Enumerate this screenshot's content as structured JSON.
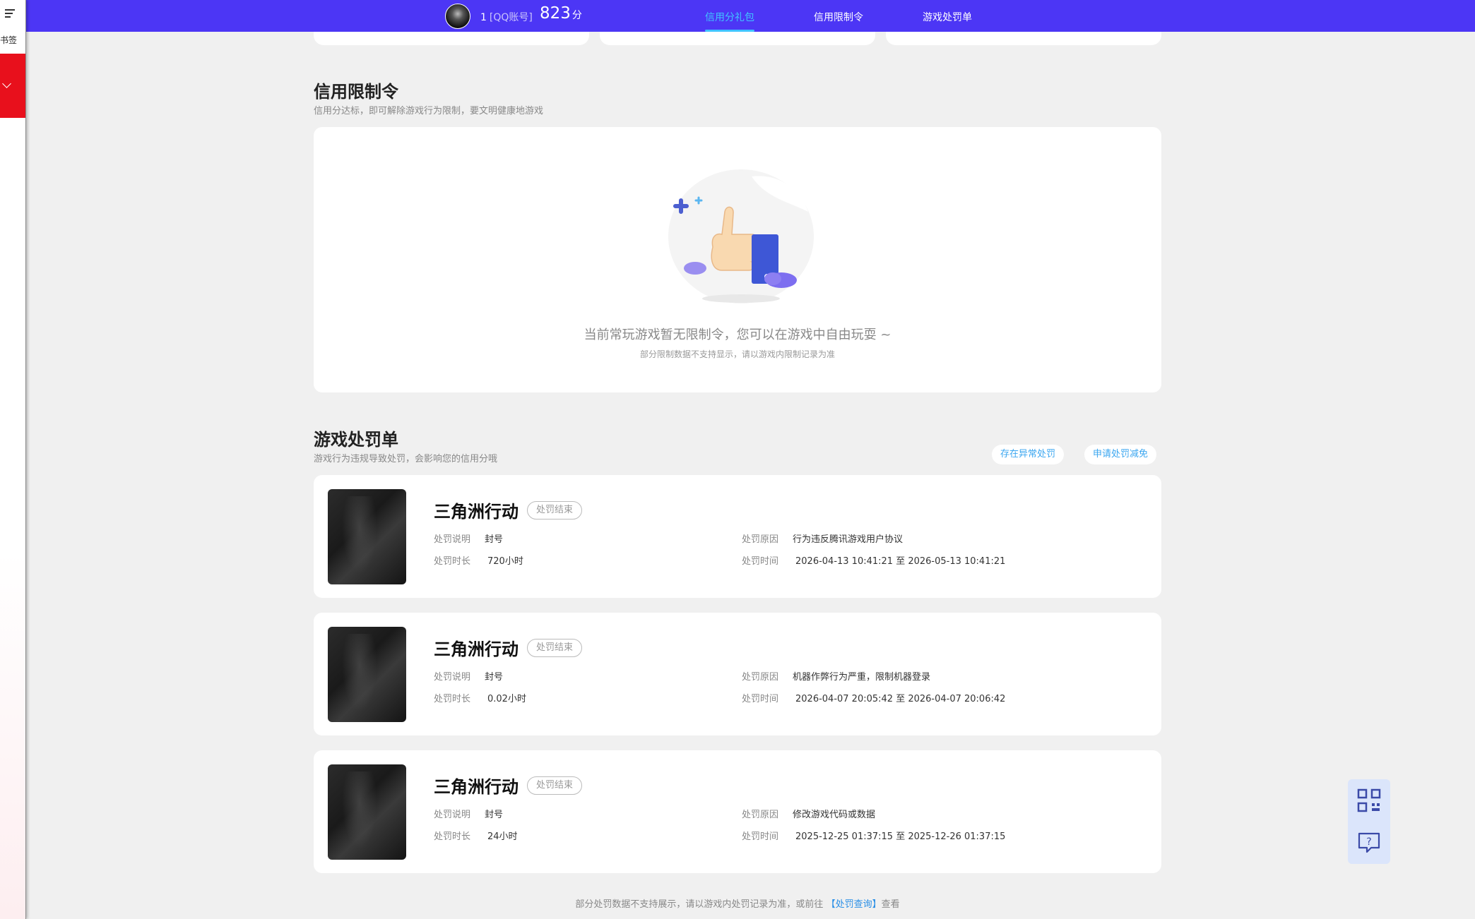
{
  "sidebar": {
    "bookmark_label": "书签"
  },
  "header": {
    "account_id": "1",
    "account_type": "[QQ账号]",
    "score": "823",
    "score_unit": "分",
    "tabs": [
      {
        "label": "信用分礼包",
        "active": true
      },
      {
        "label": "信用限制令",
        "active": false
      },
      {
        "label": "游戏处罚单",
        "active": false
      }
    ],
    "accent_color": "#4c36f5",
    "active_color": "#41c4ff"
  },
  "restriction": {
    "title": "信用限制令",
    "subtitle": "信用分达标，即可解除游戏行为限制，要文明健康地游戏",
    "empty_main": "当前常玩游戏暂无限制令，您可以在游戏中自由玩耍 ~",
    "empty_sub": "部分限制数据不支持显示，请以游戏内限制记录为准"
  },
  "penalty": {
    "title": "游戏处罚单",
    "subtitle": "游戏行为违规导致处罚，会影响您的信用分哦",
    "btn_abnormal": "存在异常处罚",
    "btn_appeal": "申请处罚减免",
    "labels": {
      "desc": "处罚说明",
      "duration": "处罚时长",
      "reason": "处罚原因",
      "time": "处罚时间"
    },
    "items": [
      {
        "game": "三角洲行动",
        "status": "处罚结束",
        "desc": "封号",
        "duration": "720小时",
        "reason": "行为违反腾讯游戏用户协议",
        "time": "2026-04-13 10:41:21 至 2026-05-13 10:41:21"
      },
      {
        "game": "三角洲行动",
        "status": "处罚结束",
        "desc": "封号",
        "duration": "0.02小时",
        "reason": "机器作弊行为严重，限制机器登录",
        "time": "2026-04-07 20:05:42 至 2026-04-07 20:06:42"
      },
      {
        "game": "三角洲行动",
        "status": "处罚结束",
        "desc": "封号",
        "duration": "24小时",
        "reason": "修改游戏代码或数据",
        "time": "2025-12-25 01:37:15 至 2025-12-26 01:37:15"
      }
    ]
  },
  "footer": {
    "text_before": "部分处罚数据不支持展示，请以游戏内处罚记录为准，或前往",
    "link": "【处罚查询】",
    "text_after": "查看"
  }
}
